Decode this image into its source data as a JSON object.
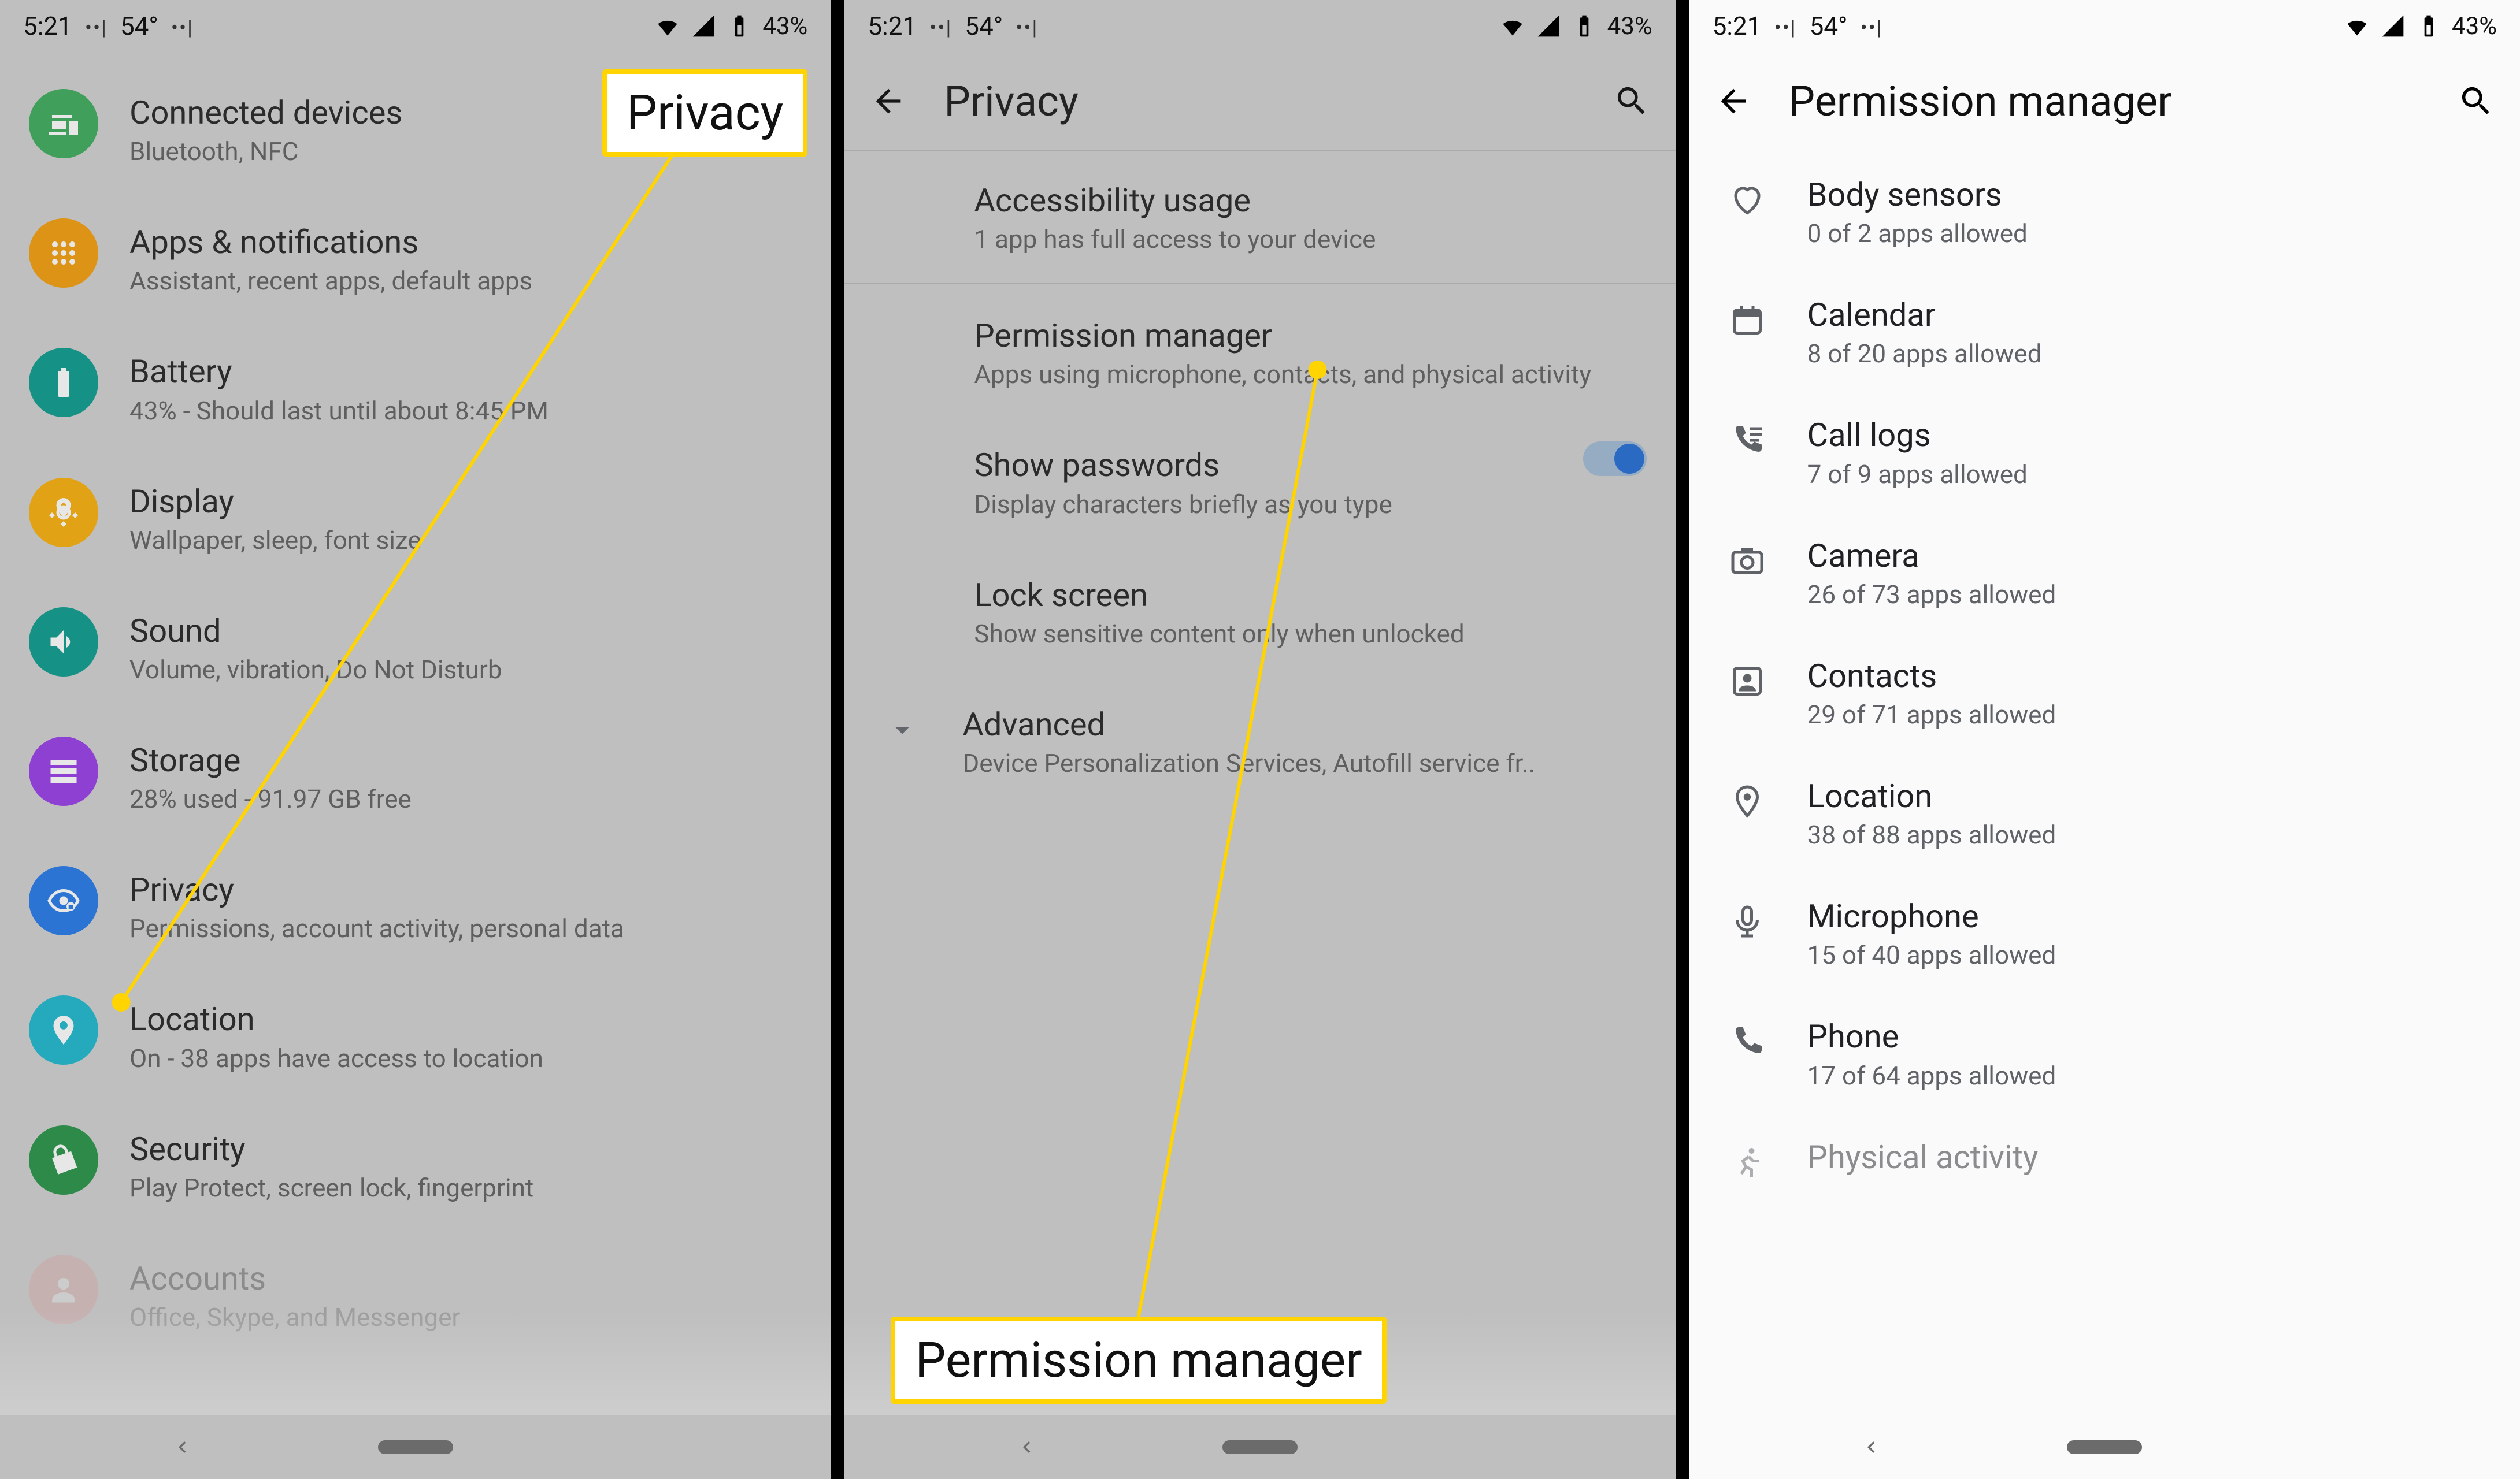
{
  "status": {
    "time": "5:21",
    "temp": "54°",
    "battery": "43%"
  },
  "screen1": {
    "callout": "Privacy",
    "items": [
      {
        "icon": "devices",
        "color": "c-green",
        "title": "Connected devices",
        "sub": "Bluetooth, NFC"
      },
      {
        "icon": "apps",
        "color": "c-orange",
        "title": "Apps & notifications",
        "sub": "Assistant, recent apps, default apps"
      },
      {
        "icon": "battery",
        "color": "c-teal",
        "title": "Battery",
        "sub": "43% - Should last until about 8:45 PM"
      },
      {
        "icon": "display",
        "color": "c-amber",
        "title": "Display",
        "sub": "Wallpaper, sleep, font size"
      },
      {
        "icon": "sound",
        "color": "c-teal2",
        "title": "Sound",
        "sub": "Volume, vibration, Do Not Disturb"
      },
      {
        "icon": "storage",
        "color": "c-purple",
        "title": "Storage",
        "sub": "28% used - 91.97 GB free"
      },
      {
        "icon": "privacy",
        "color": "c-blue",
        "title": "Privacy",
        "sub": "Permissions, account activity, personal data"
      },
      {
        "icon": "location",
        "color": "c-cyan",
        "title": "Location",
        "sub": "On - 38 apps have access to location"
      },
      {
        "icon": "security",
        "color": "c-green2",
        "title": "Security",
        "sub": "Play Protect, screen lock, fingerprint"
      },
      {
        "icon": "accounts",
        "color": "c-pink",
        "title": "Accounts",
        "sub": "Office, Skype, and Messenger"
      }
    ]
  },
  "screen2": {
    "title": "Privacy",
    "callout": "Permission manager",
    "items": [
      {
        "title": "Accessibility usage",
        "sub": "1 app has full access to your device"
      },
      {
        "title": "Permission manager",
        "sub": "Apps using microphone, contacts, and physical activity"
      },
      {
        "title": "Show passwords",
        "sub": "Display characters briefly as you type",
        "toggle": true
      },
      {
        "title": "Lock screen",
        "sub": "Show sensitive content only when unlocked"
      },
      {
        "title": "Advanced",
        "sub": "Device Personalization Services, Autofill service fr..",
        "chevron": true
      }
    ]
  },
  "screen3": {
    "title": "Permission manager",
    "items": [
      {
        "icon": "heart",
        "title": "Body sensors",
        "sub": "0 of 2 apps allowed"
      },
      {
        "icon": "calendar",
        "title": "Calendar",
        "sub": "8 of 20 apps allowed"
      },
      {
        "icon": "calllog",
        "title": "Call logs",
        "sub": "7 of 9 apps allowed"
      },
      {
        "icon": "camera",
        "title": "Camera",
        "sub": "26 of 73 apps allowed"
      },
      {
        "icon": "contacts",
        "title": "Contacts",
        "sub": "29 of 71 apps allowed"
      },
      {
        "icon": "pin",
        "title": "Location",
        "sub": "38 of 88 apps allowed"
      },
      {
        "icon": "mic",
        "title": "Microphone",
        "sub": "15 of 40 apps allowed"
      },
      {
        "icon": "phone",
        "title": "Phone",
        "sub": "17 of 64 apps allowed"
      },
      {
        "icon": "run",
        "title": "Physical activity",
        "sub": ""
      }
    ]
  }
}
